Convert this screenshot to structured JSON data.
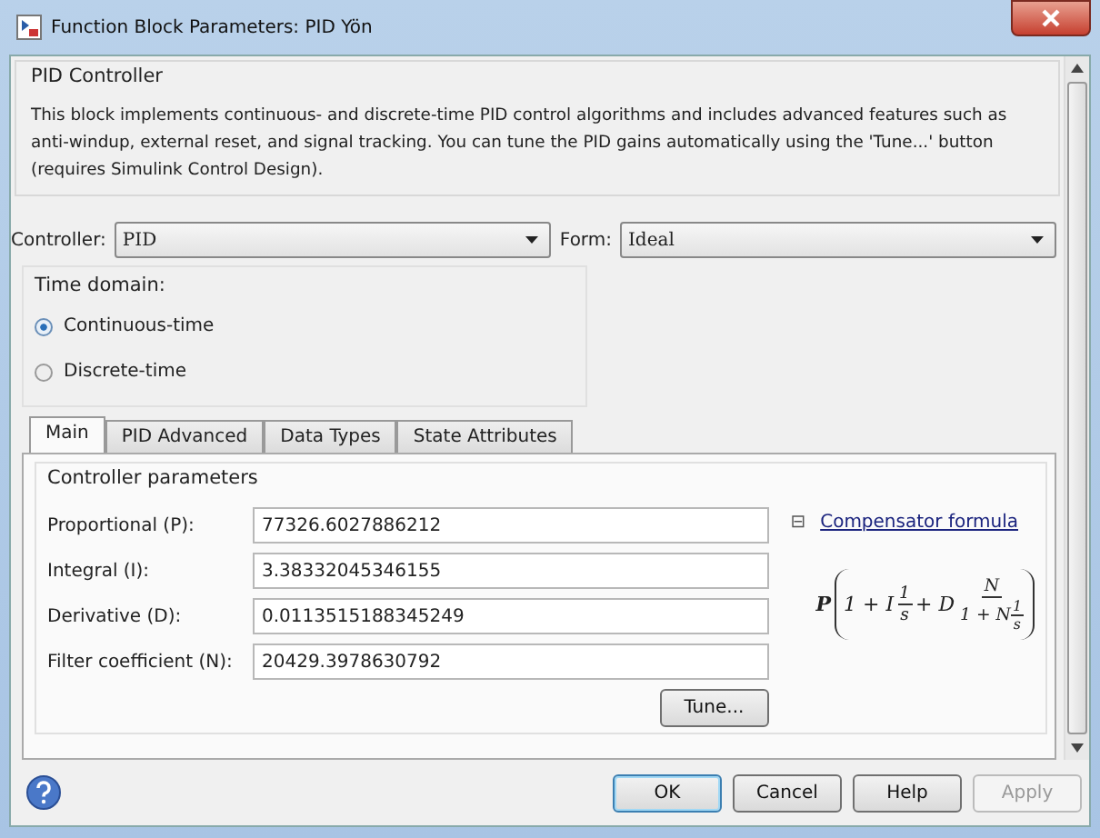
{
  "window": {
    "title": "Function Block Parameters: PID Yön"
  },
  "block": {
    "name": "PID Controller",
    "description": "This block implements continuous- and discrete-time PID control algorithms and includes advanced features such as anti-windup, external reset, and signal tracking. You can tune the PID gains automatically using the 'Tune...' button (requires Simulink Control Design)."
  },
  "controller": {
    "label": "Controller:",
    "value": "PID"
  },
  "form": {
    "label": "Form:",
    "value": "Ideal"
  },
  "time_domain": {
    "title": "Time domain:",
    "options": [
      {
        "label": "Continuous-time",
        "selected": true
      },
      {
        "label": "Discrete-time",
        "selected": false
      }
    ]
  },
  "tabs": [
    {
      "label": "Main",
      "selected": true
    },
    {
      "label": "PID Advanced",
      "selected": false
    },
    {
      "label": "Data Types",
      "selected": false
    },
    {
      "label": "State Attributes",
      "selected": false
    }
  ],
  "controller_parameters": {
    "title": "Controller parameters",
    "fields": [
      {
        "label": "Proportional (P):",
        "value": "77326.6027886212"
      },
      {
        "label": "Integral (I):",
        "value": "3.38332045346155"
      },
      {
        "label": "Derivative (D):",
        "value": "0.0113515188345249"
      },
      {
        "label": "Filter coefficient (N):",
        "value": "20429.3978630792"
      }
    ],
    "tune_button": "Tune...",
    "compensator": {
      "toggle": "⊟",
      "link": "Compensator formula"
    },
    "formula": {
      "lead": "P",
      "terms": [
        {
          "kind": "text",
          "text": "1 + I"
        },
        {
          "kind": "frac",
          "num": [
            {
              "kind": "text",
              "text": "1"
            }
          ],
          "den": [
            {
              "kind": "text",
              "text": "s"
            }
          ]
        },
        {
          "kind": "text",
          "text": "+ D"
        },
        {
          "kind": "frac",
          "num": [
            {
              "kind": "text",
              "text": "N"
            }
          ],
          "den": [
            {
              "kind": "text",
              "text": "1 + N"
            },
            {
              "kind": "frac",
              "num": [
                {
                  "kind": "text",
                  "text": "1"
                }
              ],
              "den": [
                {
                  "kind": "text",
                  "text": "s"
                }
              ]
            }
          ]
        }
      ]
    }
  },
  "buttons": [
    {
      "label": "OK",
      "default": true,
      "disabled": false
    },
    {
      "label": "Cancel",
      "default": false,
      "disabled": false
    },
    {
      "label": "Help",
      "default": false,
      "disabled": false
    },
    {
      "label": "Apply",
      "default": false,
      "disabled": true
    }
  ]
}
